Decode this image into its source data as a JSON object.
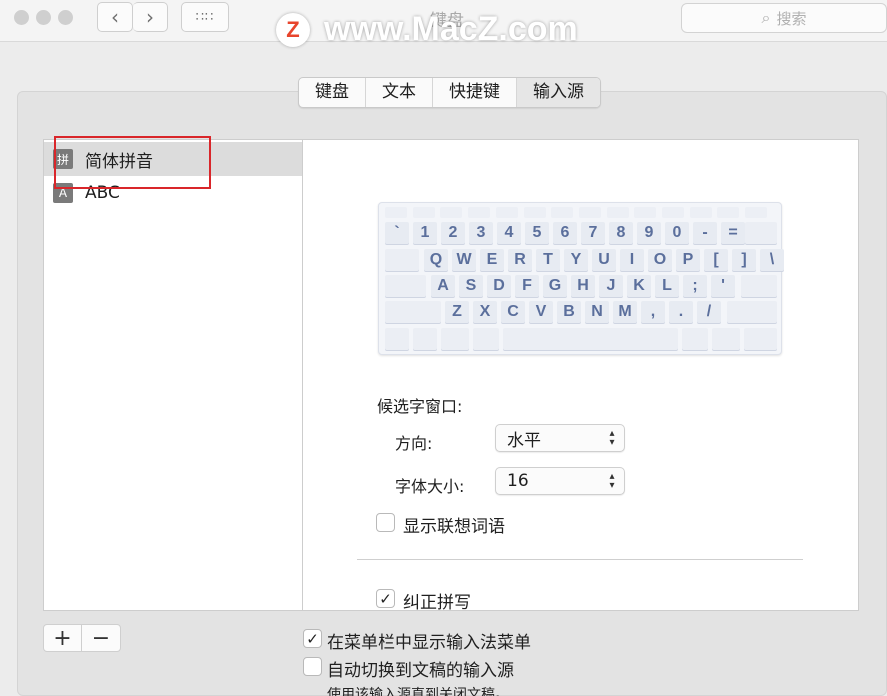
{
  "window": {
    "title": "键盘",
    "search_placeholder": "搜索",
    "watermark_logo": "Z",
    "watermark_text": "www.MacZ.com"
  },
  "tabs": [
    {
      "label": "键盘"
    },
    {
      "label": "文本"
    },
    {
      "label": "快捷键"
    },
    {
      "label": "输入源",
      "active": true
    }
  ],
  "input_sources": [
    {
      "icon": "拼",
      "label": "简体拼音",
      "selected": true
    },
    {
      "icon": "A",
      "label": "ABC",
      "selected": false
    }
  ],
  "keyboard": {
    "row1": [
      "`",
      "1",
      "2",
      "3",
      "4",
      "5",
      "6",
      "7",
      "8",
      "9",
      "0",
      "-",
      "="
    ],
    "row2": [
      "Q",
      "W",
      "E",
      "R",
      "T",
      "Y",
      "U",
      "I",
      "O",
      "P",
      "[",
      "]",
      "\\"
    ],
    "row3": [
      "A",
      "S",
      "D",
      "F",
      "G",
      "H",
      "J",
      "K",
      "L",
      ";",
      "'"
    ],
    "row4": [
      "Z",
      "X",
      "C",
      "V",
      "B",
      "N",
      "M",
      ",",
      ".",
      "/"
    ]
  },
  "options": {
    "candidate_window_label": "候选字窗口:",
    "direction_label": "方向:",
    "direction_value": "水平",
    "font_size_label": "字体大小:",
    "font_size_value": "16",
    "show_predictive_label": "显示联想词语",
    "show_predictive_checked": false,
    "correct_spelling_label": "纠正拼写",
    "correct_spelling_checked": true
  },
  "bottom": {
    "add_label": "+",
    "remove_label": "−",
    "show_menu_label": "在菜单栏中显示输入法菜单",
    "show_menu_checked": true,
    "auto_switch_label": "自动切换到文稿的输入源",
    "auto_switch_checked": false,
    "note": "使用该输入源直到关闭文稿。"
  }
}
